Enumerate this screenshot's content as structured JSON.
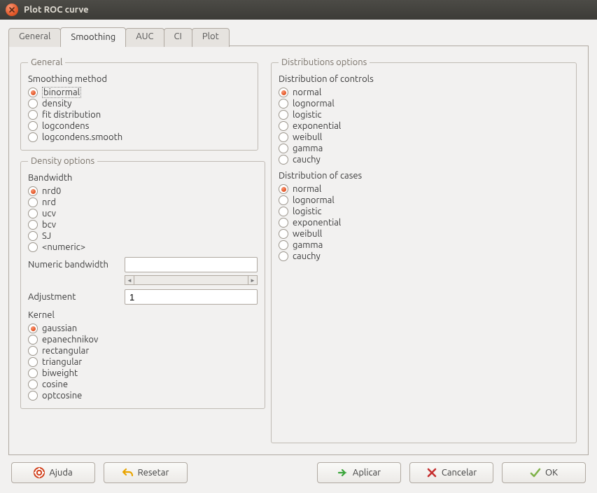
{
  "window": {
    "title": "Plot ROC curve"
  },
  "tabs": {
    "general": "General",
    "smoothing": "Smoothing",
    "auc": "AUC",
    "ci": "CI",
    "plot": "Plot",
    "active": "Smoothing"
  },
  "groups": {
    "general": {
      "legend": "General",
      "method_label": "Smoothing method",
      "methods": {
        "binormal": "binormal",
        "density": "density",
        "fitdist": "fit distribution",
        "logcondens": "logcondens",
        "logcondens_smooth": "logcondens.smooth"
      },
      "selected": "binormal"
    },
    "density": {
      "legend": "Density options",
      "bandwidth_label": "Bandwidth",
      "bandwidths": {
        "nrd0": "nrd0",
        "nrd": "nrd",
        "ucv": "ucv",
        "bcv": "bcv",
        "sj": "SJ",
        "numeric": "<numeric>"
      },
      "bandwidth_selected": "nrd0",
      "numeric_bw_label": "Numeric bandwidth",
      "numeric_bw_value": "",
      "adjustment_label": "Adjustment",
      "adjustment_value": "1",
      "kernel_label": "Kernel",
      "kernels": {
        "gaussian": "gaussian",
        "epanechnikov": "epanechnikov",
        "rectangular": "rectangular",
        "triangular": "triangular",
        "biweight": "biweight",
        "cosine": "cosine",
        "optcosine": "optcosine"
      },
      "kernel_selected": "gaussian"
    },
    "dist": {
      "legend": "Distributions options",
      "controls_label": "Distribution of controls",
      "cases_label": "Distribution of cases",
      "options": {
        "normal": "normal",
        "lognormal": "lognormal",
        "logistic": "logistic",
        "exponential": "exponential",
        "weibull": "weibull",
        "gamma": "gamma",
        "cauchy": "cauchy"
      },
      "controls_selected": "normal",
      "cases_selected": "normal"
    }
  },
  "buttons": {
    "help": "Ajuda",
    "reset": "Resetar",
    "apply": "Aplicar",
    "cancel": "Cancelar",
    "ok": "OK"
  }
}
